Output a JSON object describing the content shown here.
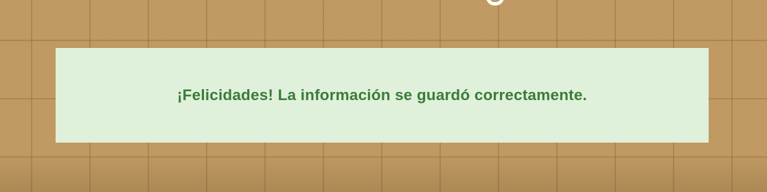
{
  "alert": {
    "message": "¡Felicidades! La información se guardó correctamente.",
    "type": "success",
    "background_color": "#dff1da",
    "text_color": "#3c7a3a"
  },
  "background": {
    "style": "tiled-wall",
    "color": "#c09a62"
  }
}
